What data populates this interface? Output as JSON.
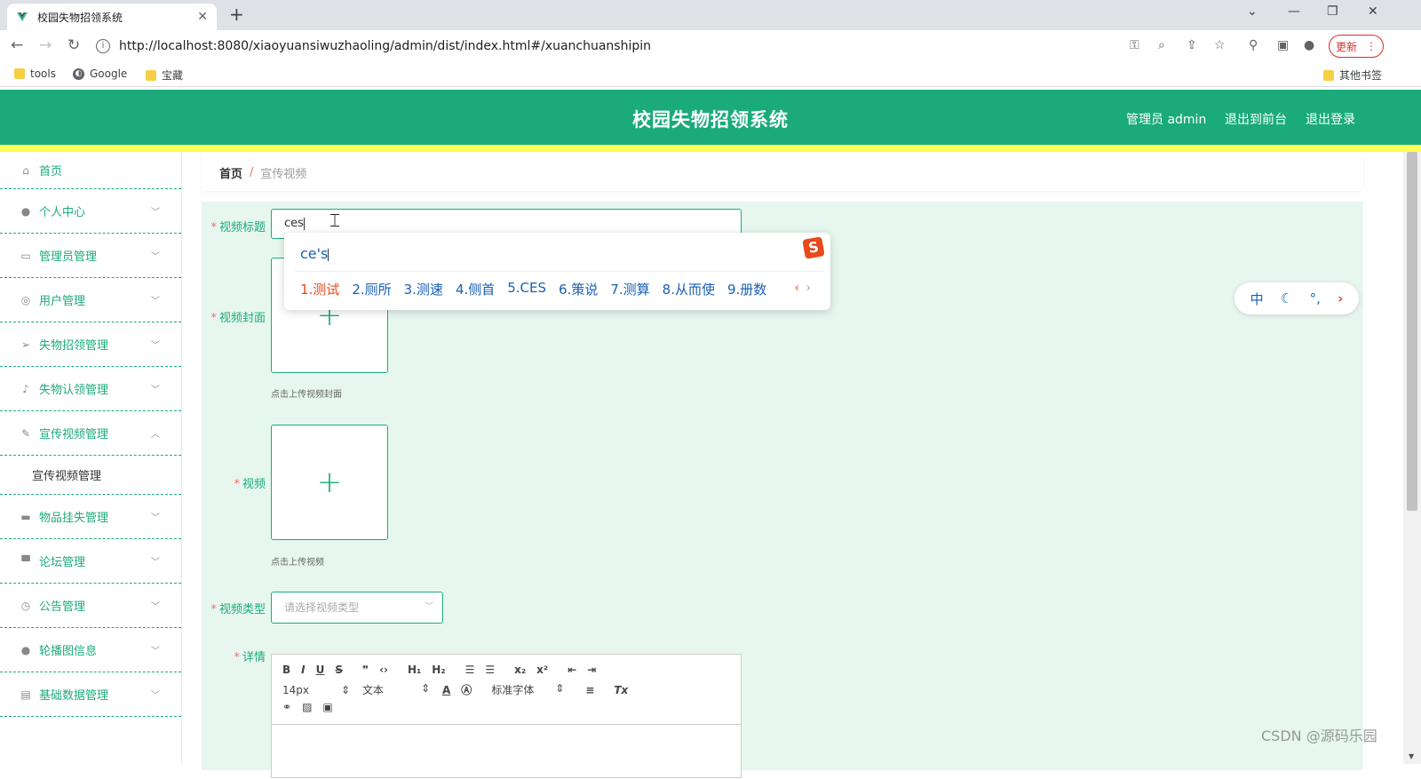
{
  "browser": {
    "tab_title": "校园失物招领系统",
    "url": "http://localhost:8080/xiaoyuansiwuzhaoling/admin/dist/index.html#/xuanchuanshipin",
    "update_label": "更新",
    "bookmarks": [
      "tools",
      "Google",
      "宝藏"
    ],
    "other_bookmarks": "其他书签"
  },
  "header": {
    "title": "校园失物招领系统",
    "admin_label": "管理员 admin",
    "exit_front": "退出到前台",
    "logout": "退出登录"
  },
  "sidebar": {
    "items": [
      {
        "label": "首页",
        "icon": "home-icon"
      },
      {
        "label": "个人中心",
        "icon": "user-icon"
      },
      {
        "label": "管理员管理",
        "icon": "card-icon"
      },
      {
        "label": "用户管理",
        "icon": "help-icon"
      },
      {
        "label": "失物招领管理",
        "icon": "send-icon"
      },
      {
        "label": "失物认领管理",
        "icon": "mic-icon"
      },
      {
        "label": "宣传视频管理",
        "icon": "edit-icon"
      },
      {
        "label": "物品挂失管理",
        "icon": "briefcase-icon"
      },
      {
        "label": "论坛管理",
        "icon": "monitor-icon"
      },
      {
        "label": "公告管理",
        "icon": "clock-icon"
      },
      {
        "label": "轮播图信息",
        "icon": "user-icon"
      },
      {
        "label": "基础数据管理",
        "icon": "clipboard-icon"
      }
    ],
    "submenu_label": "宣传视频管理"
  },
  "breadcrumb": {
    "home": "首页",
    "separator": "/",
    "current": "宣传视频"
  },
  "form": {
    "title_label": "视频标题",
    "title_value": "ces",
    "cover_label": "视频封面",
    "cover_hint": "点击上传视频封面",
    "video_label": "视频",
    "video_hint": "点击上传视频",
    "type_label": "视频类型",
    "type_placeholder": "请选择视频类型",
    "detail_label": "详情",
    "editor": {
      "font_size": "14px",
      "block_type": "文本",
      "font_family": "标准字体"
    }
  },
  "ime": {
    "composition": "ce's",
    "candidates": [
      "1.测试",
      "2.厕所",
      "3.测速",
      "4.侧首",
      "5.CES",
      "6.策说",
      "7.测算",
      "8.从而使",
      "9.册数"
    ],
    "status_mode": "中"
  },
  "watermark": "CSDN @源码乐园",
  "colors": {
    "primary": "#1bab7b",
    "accent_bar": "#ffff55",
    "form_bg": "#e7f7f0",
    "required": "#f56c6c"
  }
}
